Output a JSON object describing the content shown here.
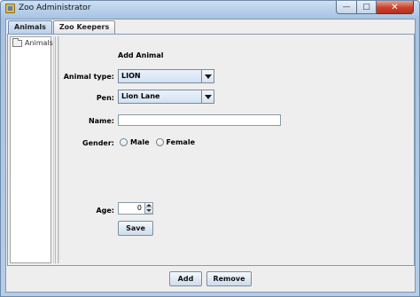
{
  "window": {
    "title": "Zoo Administrator",
    "controls": {
      "minimize": "—",
      "maximize": "□",
      "close": "✕"
    }
  },
  "tabs": [
    {
      "label": "Animals",
      "active": true
    },
    {
      "label": "Zoo Keepers",
      "active": false
    }
  ],
  "tree": {
    "root_label": "Animals"
  },
  "form": {
    "title": "Add Animal",
    "animal_type_label": "Animal type:",
    "animal_type_value": "LION",
    "pen_label": "Pen:",
    "pen_value": "Lion Lane",
    "name_label": "Name:",
    "name_value": "",
    "gender_label": "Gender:",
    "gender_options": [
      "Male",
      "Female"
    ],
    "age_label": "Age:",
    "age_value": "0",
    "save_label": "Save"
  },
  "actions": {
    "add_label": "Add",
    "remove_label": "Remove"
  },
  "colors": {
    "title_gradient": "#bcd3ec",
    "close_button": "#c9412a",
    "tab_active": "#b8d0eb"
  }
}
